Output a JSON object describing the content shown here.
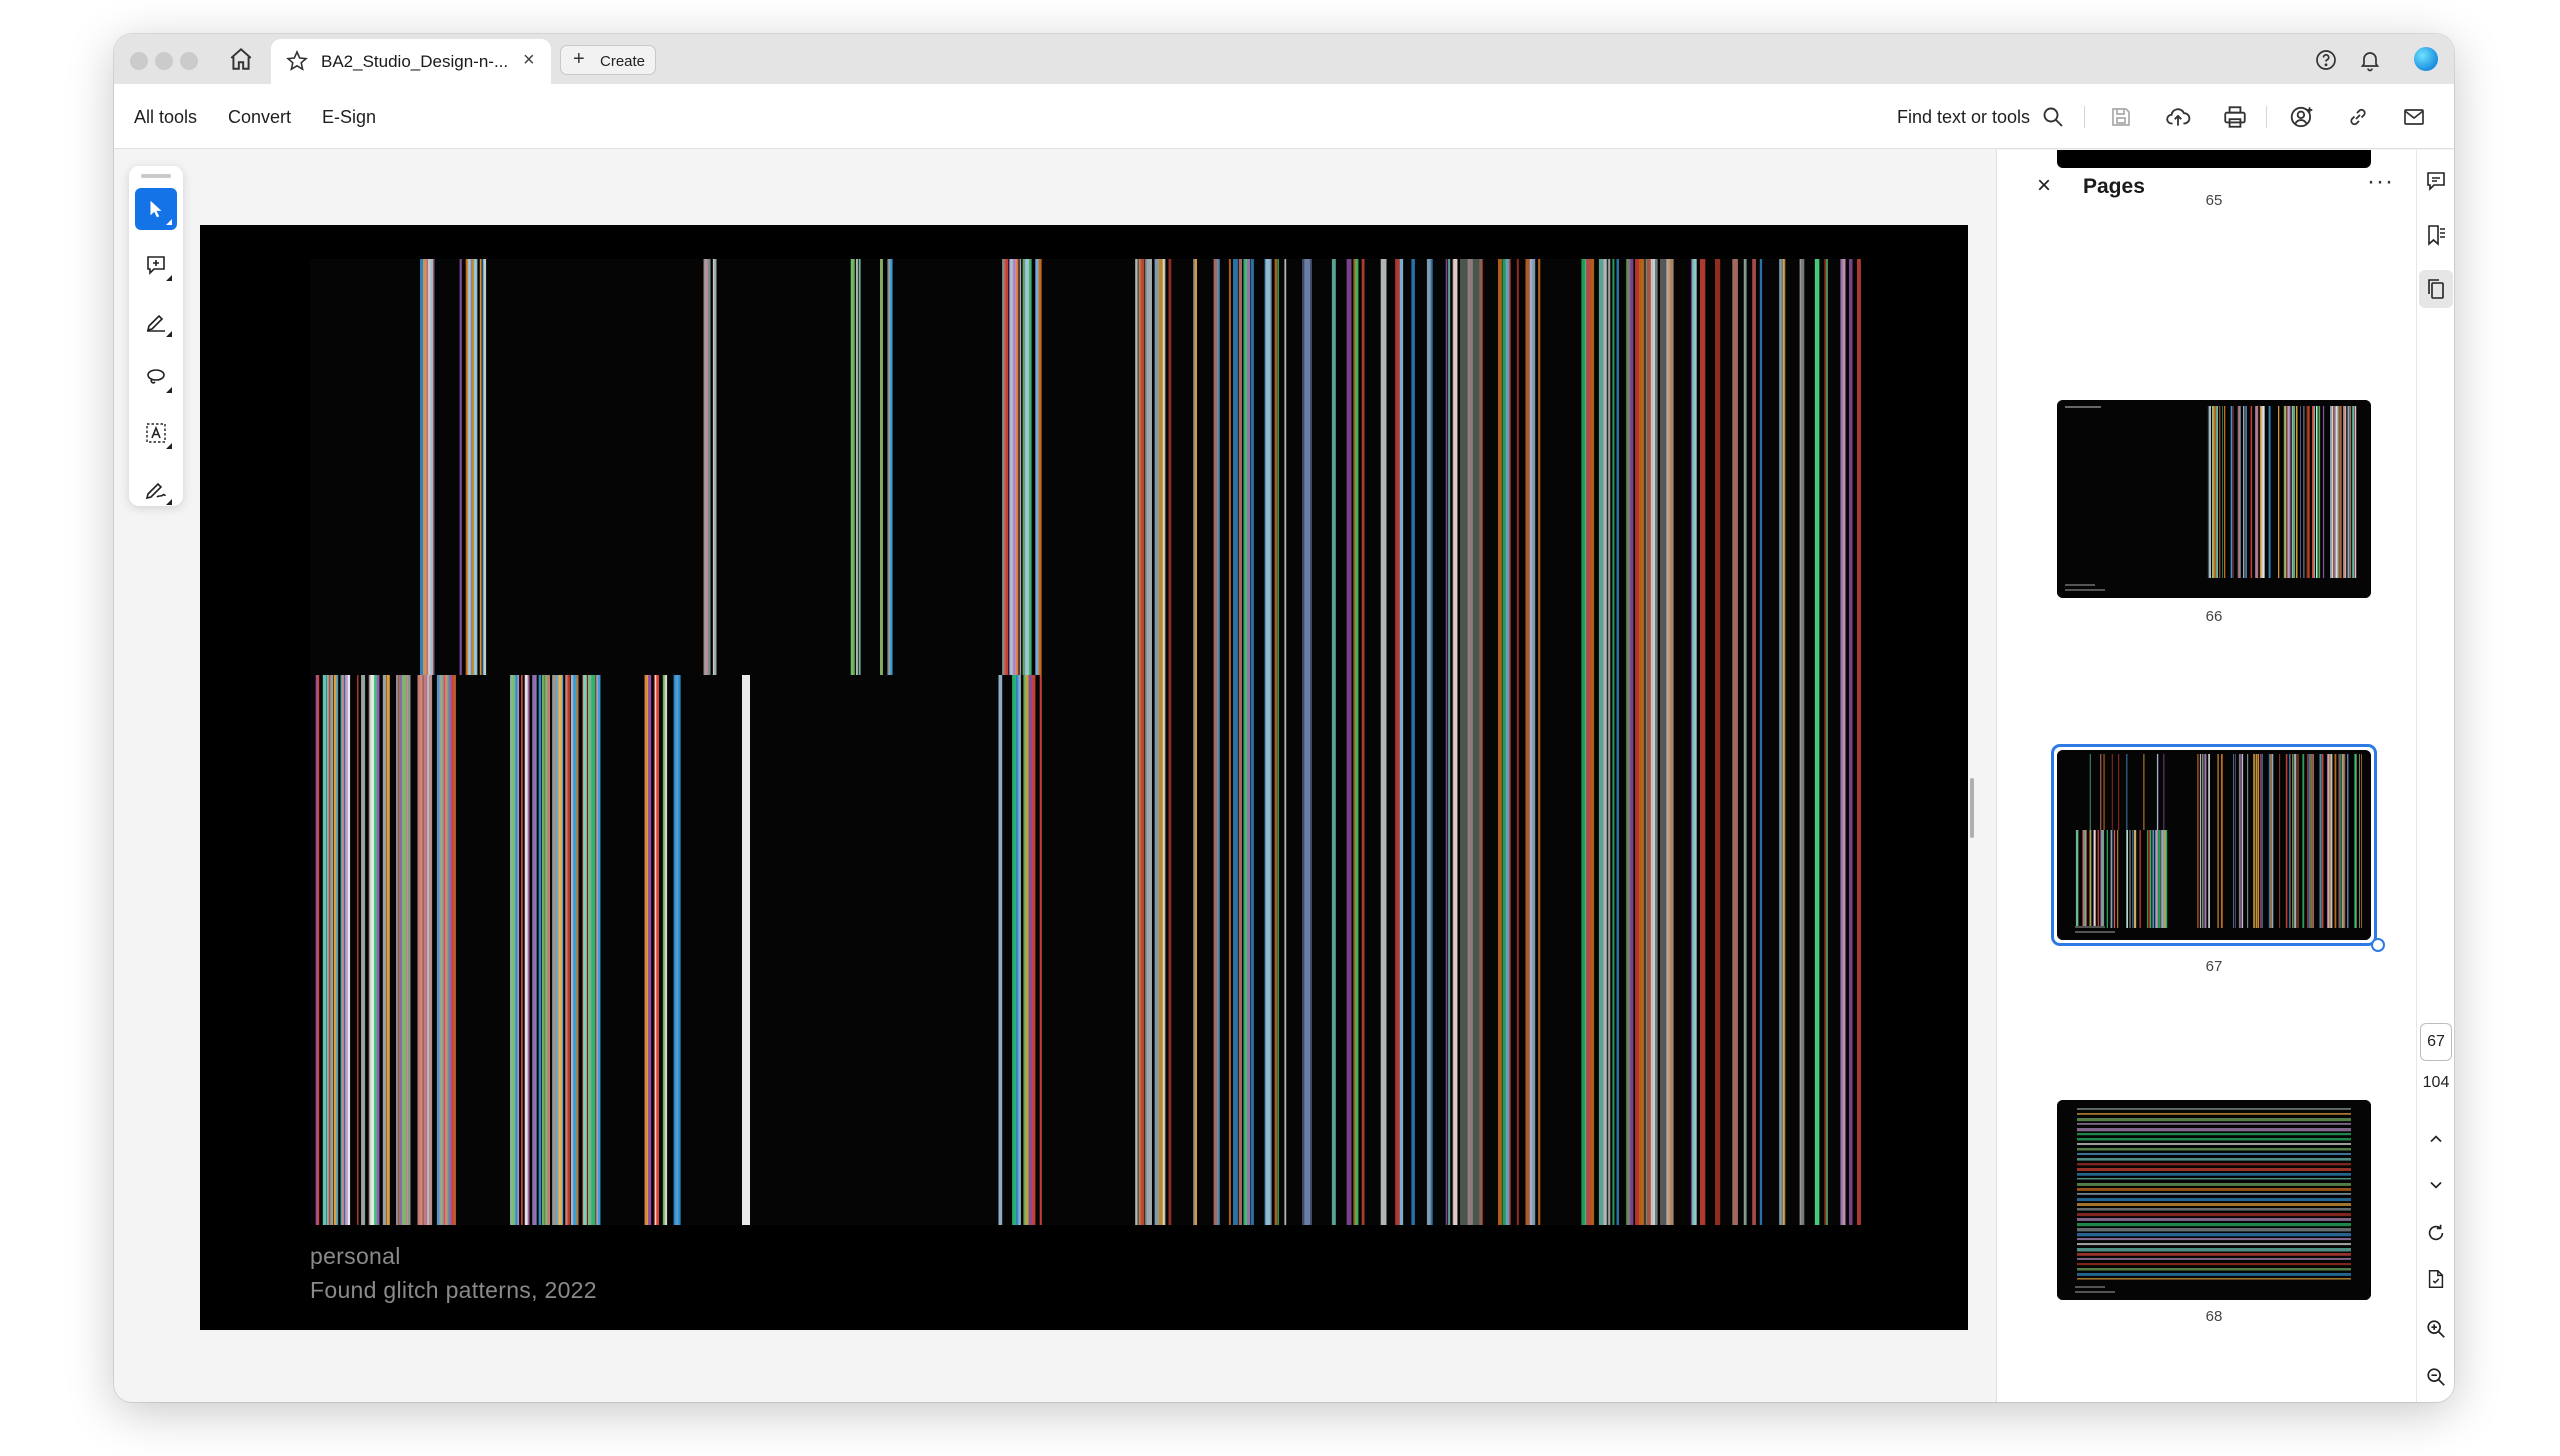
{
  "window": {
    "tab_title": "BA2_Studio_Design-n-...",
    "tab_close": "×",
    "create_label": "Create",
    "create_plus": "+"
  },
  "toolbar": {
    "menu": [
      "All tools",
      "Convert",
      "E-Sign"
    ],
    "find_label": "Find text or tools"
  },
  "document": {
    "caption_line1": "personal",
    "caption_line2": "Found glitch patterns, 2022"
  },
  "pages_panel": {
    "close": "×",
    "title": "Pages",
    "more": "···",
    "thumbnails": [
      {
        "label": "65"
      },
      {
        "label": "66"
      },
      {
        "label": "67",
        "selected": true
      },
      {
        "label": "68"
      }
    ]
  },
  "navigation": {
    "current_page": "67",
    "total_pages": "104"
  },
  "icons": {
    "home": "home-icon",
    "favorite": "star-icon",
    "help": "help-icon",
    "notifications": "bell-icon",
    "search": "search-icon",
    "save": "save-icon",
    "upload": "cloud-upload-icon",
    "print": "print-icon",
    "share": "share-user-icon",
    "link": "link-icon",
    "email": "mail-icon"
  },
  "colors": {
    "accent": "#1473e6",
    "selection": "#2c7be5",
    "page_bg": "#000000",
    "caption": "#8a8a8a"
  }
}
